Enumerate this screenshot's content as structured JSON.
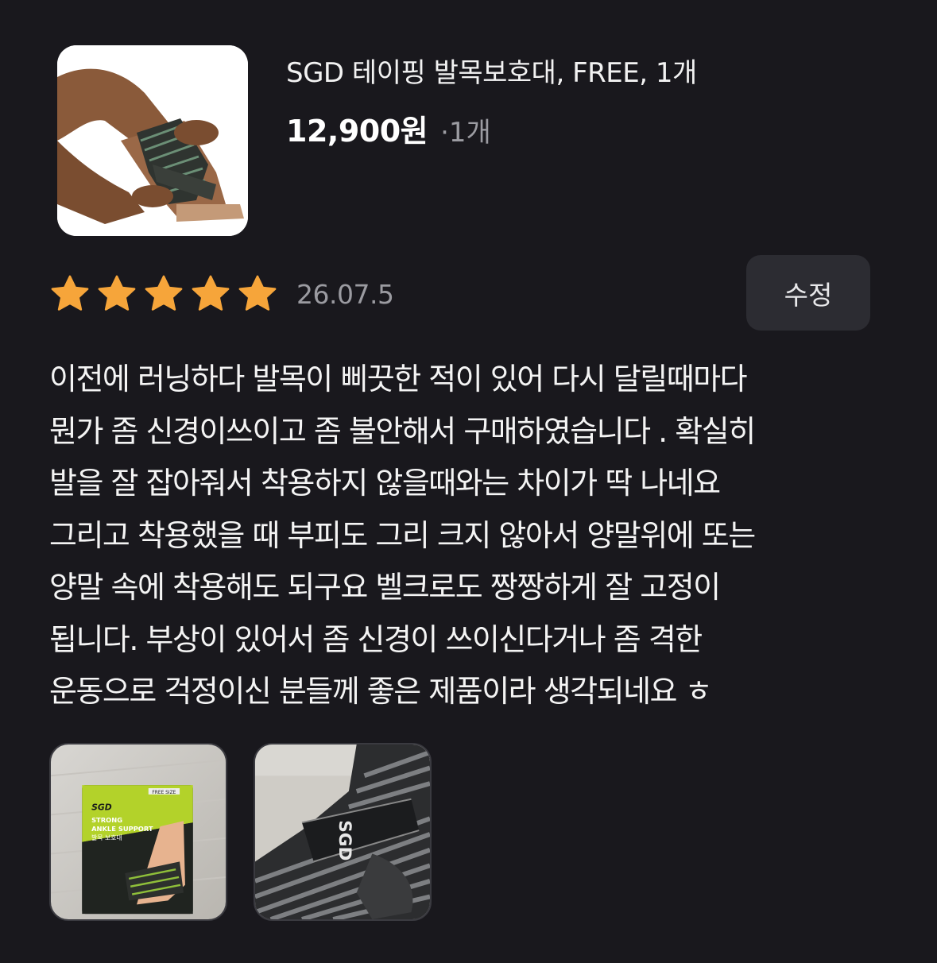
{
  "product": {
    "name": "SGD 테이핑 발목보호대, FREE, 1개",
    "price": "12,900원",
    "quantity": "·1개",
    "thumbnail_icon": "ankle-brace-product-photo"
  },
  "review": {
    "rating": 5,
    "rating_max": 5,
    "star_color": "#f6a53a",
    "date": "26.07.5",
    "edit_label": "수정",
    "lines": [
      "이전에 러닝하다 발목이 삐끗한 적이 있어 다시 달릴때마다",
      "뭔가 좀 신경이쓰이고 좀 불안해서 구매하였습니다 . 확실히",
      "발을 잘 잡아줘서 착용하지 않을때와는 차이가 딱 나네요",
      "그리고 착용했을 때 부피도 그리 크지 않아서 양말위에 또는",
      "양말 속에 착용해도 되구요 벨크로도 짱짱하게 잘 고정이",
      "됩니다. 부상이 있어서 좀 신경이 쓰이신다거나 좀 격한",
      "운동으로 걱정이신 분들께 좋은 제품이라 생각되네요 ㅎ"
    ]
  },
  "photos": [
    {
      "name": "package-photo",
      "brand": "SGD",
      "line1": "STRONG",
      "line2": "ANKLE SUPPORT",
      "line3": "발목 보호대",
      "size_tag": "FREE SIZE"
    },
    {
      "name": "worn-brace-photo",
      "strap_logo": "SGD"
    }
  ]
}
